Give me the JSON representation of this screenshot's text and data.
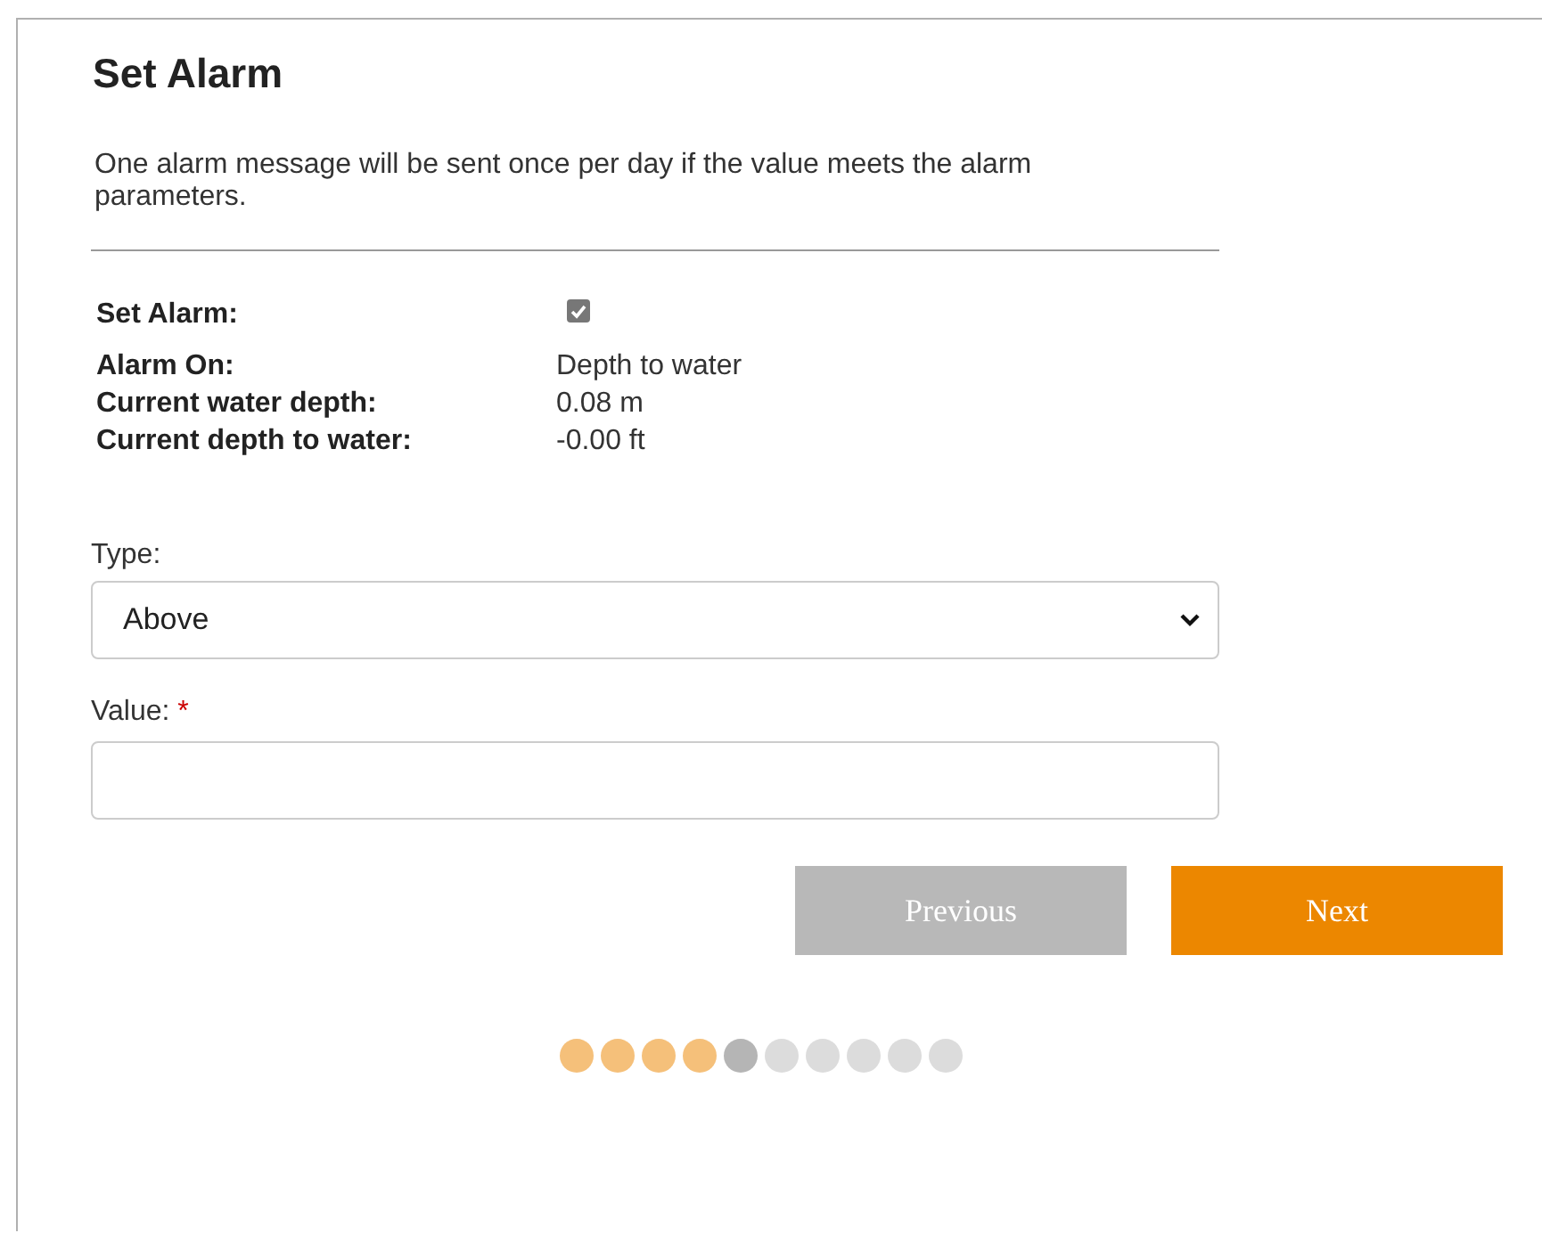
{
  "title": "Set Alarm",
  "description": "One alarm message will be sent once per day if the value meets the alarm parameters.",
  "set_alarm": {
    "label": "Set Alarm:",
    "checked": true
  },
  "info": [
    {
      "label": "Alarm On:",
      "value": "Depth to water"
    },
    {
      "label": "Current water depth:",
      "value": "0.08 m"
    },
    {
      "label": "Current depth to water:",
      "value": "-0.00 ft"
    }
  ],
  "type_field": {
    "label": "Type:",
    "value": "Above"
  },
  "value_field": {
    "label": "Value:",
    "required_mark": "*"
  },
  "buttons": {
    "previous": "Previous",
    "next": "Next"
  },
  "steps": [
    {
      "done": true,
      "selected": false
    },
    {
      "done": true,
      "selected": false
    },
    {
      "done": true,
      "selected": false
    },
    {
      "done": true,
      "selected": false
    },
    {
      "done": false,
      "selected": true
    },
    {
      "done": false,
      "selected": false
    },
    {
      "done": false,
      "selected": false
    },
    {
      "done": false,
      "selected": false
    },
    {
      "done": false,
      "selected": false
    },
    {
      "done": false,
      "selected": false
    }
  ]
}
